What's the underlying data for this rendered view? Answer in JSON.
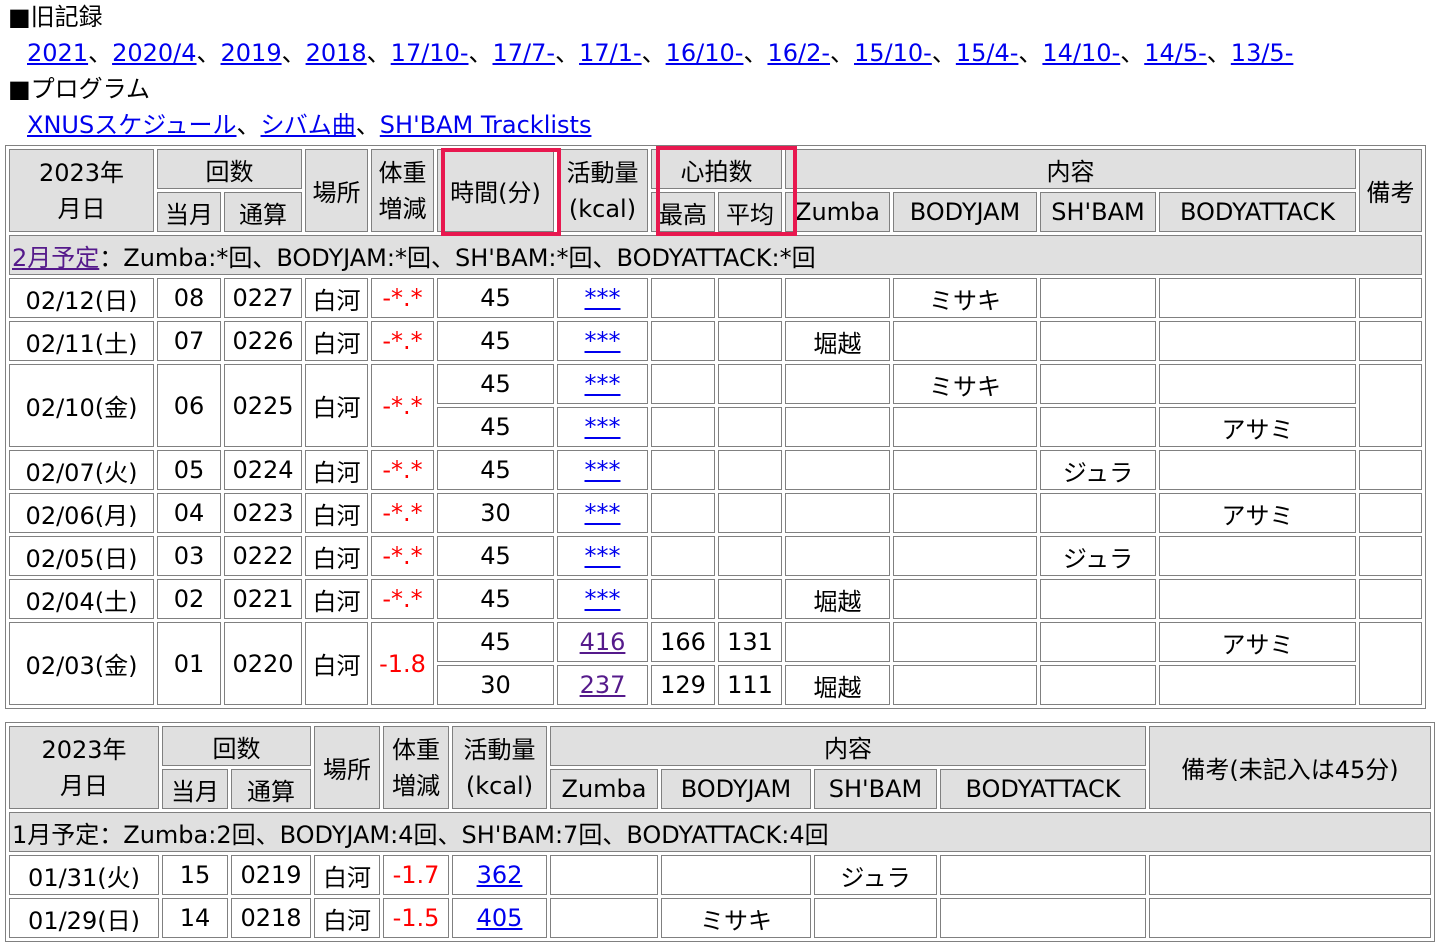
{
  "sections": {
    "old_records_title": "■旧記録",
    "old_records_links": [
      "2021",
      "2020/4",
      "2019",
      "2018",
      "17/10-",
      "17/7-",
      "17/1-",
      "16/10-",
      "16/2-",
      "15/10-",
      "15/4-",
      "14/10-",
      "14/5-",
      "13/5-"
    ],
    "separator": "、",
    "program_title": "■プログラム",
    "program_links": [
      "XNUSスケジュール",
      "シバム曲",
      "SH'BAM Tracklists"
    ]
  },
  "feb": {
    "header": {
      "year_date": [
        "2023年",
        "月日"
      ],
      "count": "回数",
      "month": "当月",
      "total": "通算",
      "place": "場所",
      "weight": [
        "体重",
        "増減"
      ],
      "time": "時間(分)",
      "activity": [
        "活動量",
        "(kcal)"
      ],
      "heart": "心拍数",
      "hr_max": "最高",
      "hr_avg": "平均",
      "content": "内容",
      "zumba": "Zumba",
      "bodyjam": "BODYJAM",
      "shbam": "SH'BAM",
      "bodyattack": "BODYATTACK",
      "notes": "備考"
    },
    "plan_link": "2月予定",
    "plan_text": "：Zumba:*回、BODYJAM:*回、SH'BAM:*回、BODYATTACK:*回",
    "rows": [
      {
        "date": "02/12(日)",
        "month": "08",
        "total": "0227",
        "place": "白河",
        "weight": "-*.*",
        "time": "45",
        "kcal": "***",
        "max": "",
        "avg": "",
        "zumba": "",
        "bodyjam": "ミサキ",
        "shbam": "",
        "attack": ""
      },
      {
        "date": "02/11(土)",
        "month": "07",
        "total": "0226",
        "place": "白河",
        "weight": "-*.*",
        "time": "45",
        "kcal": "***",
        "max": "",
        "avg": "",
        "zumba": "堀越",
        "bodyjam": "",
        "shbam": "",
        "attack": ""
      },
      {
        "date": "02/10(金)",
        "month": "06",
        "total": "0225",
        "place": "白河",
        "weight": "-*.*",
        "time": "45",
        "kcal": "***",
        "max": "",
        "avg": "",
        "zumba": "",
        "bodyjam": "ミサキ",
        "shbam": "",
        "attack": "",
        "sub": {
          "time": "45",
          "kcal": "***",
          "max": "",
          "avg": "",
          "zumba": "",
          "bodyjam": "",
          "shbam": "",
          "attack": "アサミ"
        }
      },
      {
        "date": "02/07(火)",
        "month": "05",
        "total": "0224",
        "place": "白河",
        "weight": "-*.*",
        "time": "45",
        "kcal": "***",
        "max": "",
        "avg": "",
        "zumba": "",
        "bodyjam": "",
        "shbam": "ジュラ",
        "attack": ""
      },
      {
        "date": "02/06(月)",
        "month": "04",
        "total": "0223",
        "place": "白河",
        "weight": "-*.*",
        "time": "30",
        "kcal": "***",
        "max": "",
        "avg": "",
        "zumba": "",
        "bodyjam": "",
        "shbam": "",
        "attack": "アサミ"
      },
      {
        "date": "02/05(日)",
        "month": "03",
        "total": "0222",
        "place": "白河",
        "weight": "-*.*",
        "time": "45",
        "kcal": "***",
        "max": "",
        "avg": "",
        "zumba": "",
        "bodyjam": "",
        "shbam": "ジュラ",
        "attack": ""
      },
      {
        "date": "02/04(土)",
        "month": "02",
        "total": "0221",
        "place": "白河",
        "weight": "-*.*",
        "time": "45",
        "kcal": "***",
        "max": "",
        "avg": "",
        "zumba": "堀越",
        "bodyjam": "",
        "shbam": "",
        "attack": ""
      },
      {
        "date": "02/03(金)",
        "month": "01",
        "total": "0220",
        "place": "白河",
        "weight": "-1.8",
        "time": "45",
        "kcal": "416",
        "max": "166",
        "avg": "131",
        "zumba": "",
        "bodyjam": "",
        "shbam": "",
        "attack": "アサミ",
        "sub": {
          "time": "30",
          "kcal": "237",
          "max": "129",
          "avg": "111",
          "zumba": "堀越",
          "bodyjam": "",
          "shbam": "",
          "attack": ""
        }
      }
    ]
  },
  "jan": {
    "header": {
      "year_date": [
        "2023年",
        "月日"
      ],
      "count": "回数",
      "month": "当月",
      "total": "通算",
      "place": "場所",
      "weight": [
        "体重",
        "増減"
      ],
      "activity": [
        "活動量",
        "(kcal)"
      ],
      "content": "内容",
      "zumba": "Zumba",
      "bodyjam": "BODYJAM",
      "shbam": "SH'BAM",
      "bodyattack": "BODYATTACK",
      "notes": "備考(未記入は45分)"
    },
    "plan_text": "1月予定：Zumba:2回、BODYJAM:4回、SH'BAM:7回、BODYATTACK:4回",
    "rows": [
      {
        "date": "01/31(火)",
        "month": "15",
        "total": "0219",
        "place": "白河",
        "weight": "-1.7",
        "kcal": "362",
        "zumba": "",
        "bodyjam": "",
        "shbam": "ジュラ",
        "attack": "",
        "notes": ""
      },
      {
        "date": "01/29(日)",
        "month": "14",
        "total": "0218",
        "place": "白河",
        "weight": "-1.5",
        "kcal": "405",
        "zumba": "",
        "bodyjam": "ミサキ",
        "shbam": "",
        "attack": "",
        "notes": ""
      }
    ]
  }
}
